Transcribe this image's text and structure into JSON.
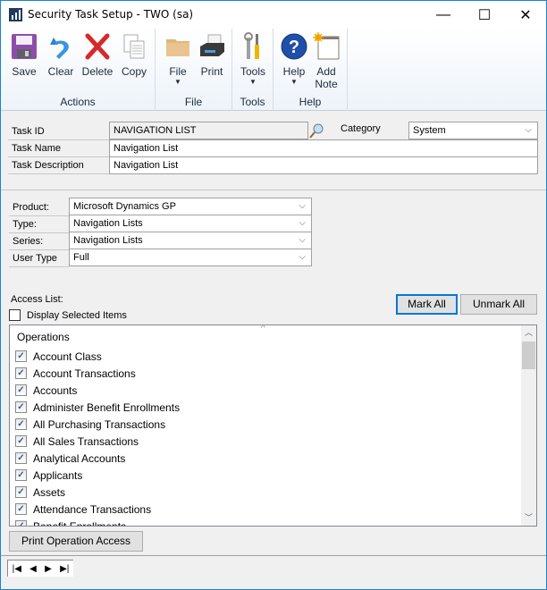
{
  "window": {
    "title": "Security Task Setup  -  TWO (sa)",
    "minimize": "—",
    "maximize": "☐",
    "close": "✕"
  },
  "ribbon": {
    "groups": [
      {
        "label": "Actions",
        "buttons": [
          {
            "label": "Save",
            "icon": "save-icon"
          },
          {
            "label": "Clear",
            "icon": "undo-icon"
          },
          {
            "label": "Delete",
            "icon": "delete-icon"
          },
          {
            "label": "Copy",
            "icon": "copy-icon"
          }
        ]
      },
      {
        "label": "File",
        "buttons": [
          {
            "label": "File",
            "icon": "folder-icon",
            "dropdown": true
          },
          {
            "label": "Print",
            "icon": "printer-icon"
          }
        ]
      },
      {
        "label": "Tools",
        "buttons": [
          {
            "label": "Tools",
            "icon": "tools-icon",
            "dropdown": true
          }
        ]
      },
      {
        "label": "Help",
        "buttons": [
          {
            "label": "Help",
            "icon": "help-icon",
            "dropdown": true
          },
          {
            "label": "Add",
            "label2": "Note",
            "icon": "note-icon"
          }
        ]
      }
    ],
    "caret": "▼"
  },
  "task": {
    "id_label": "Task ID",
    "id_value": "NAVIGATION LIST",
    "name_label": "Task Name",
    "name_value": "Navigation List",
    "desc_label": "Task Description",
    "desc_value": "Navigation List",
    "category_label": "Category",
    "category_value": "System"
  },
  "filters": {
    "product_label": "Product:",
    "product_value": "Microsoft Dynamics GP",
    "type_label": "Type:",
    "type_value": "Navigation Lists",
    "series_label": "Series:",
    "series_value": "Navigation Lists",
    "usertype_label": "User Type",
    "usertype_value": "Full"
  },
  "access": {
    "label": "Access List:",
    "display_selected": "Display Selected Items",
    "display_selected_checked": false,
    "mark_all": "Mark All",
    "unmark_all": "Unmark All",
    "column_header": "Operations",
    "items": [
      {
        "label": "Account Class",
        "checked": true
      },
      {
        "label": "Account Transactions",
        "checked": true
      },
      {
        "label": "Accounts",
        "checked": true
      },
      {
        "label": "Administer Benefit Enrollments",
        "checked": true
      },
      {
        "label": "All Purchasing Transactions",
        "checked": true
      },
      {
        "label": "All Sales Transactions",
        "checked": true
      },
      {
        "label": "Analytical Accounts",
        "checked": true
      },
      {
        "label": "Applicants",
        "checked": true
      },
      {
        "label": "Assets",
        "checked": true
      },
      {
        "label": "Attendance Transactions",
        "checked": true
      },
      {
        "label": "Benefit Enrollments",
        "checked": true
      }
    ],
    "print_button": "Print Operation Access"
  },
  "nav": {
    "first": "|◀",
    "prev": "◀",
    "next": "▶",
    "last": "▶|"
  }
}
